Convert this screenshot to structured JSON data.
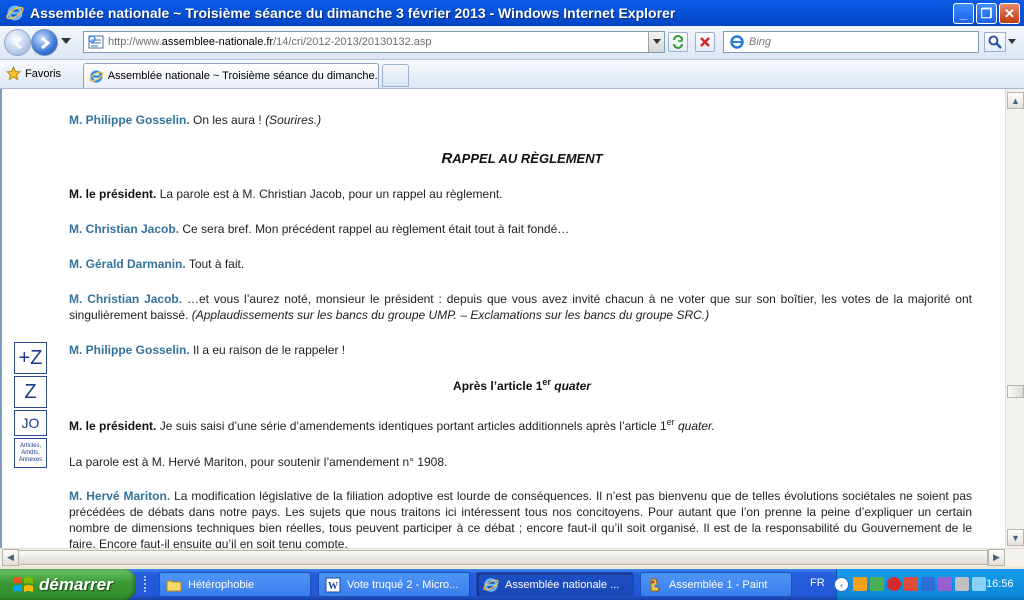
{
  "window": {
    "title": "Assemblée nationale ~ Troisième séance du dimanche 3 février 2013 - Windows Internet Explorer"
  },
  "navbar": {
    "url_prefix": "http://www.",
    "url_domain": "assemblee-nationale.fr",
    "url_path": "/14/cri/2012-2013/20130132.asp",
    "search_placeholder": "Bing"
  },
  "favbar": {
    "favorites_label": "Favoris",
    "tab_label": "Assemblée nationale ~ Troisième séance du dimanche..."
  },
  "content": {
    "p1": {
      "speaker": "M. Philippe Gosselin.",
      "text": " On les aura ! ",
      "aside": "(Sourires.)"
    },
    "heading1": {
      "first": "R",
      "rest": "APPEL AU RÈGLEMENT"
    },
    "p2": {
      "speaker": "M. le président.",
      "text": " La parole est à M. Christian Jacob, pour un rappel au règlement."
    },
    "p3": {
      "speaker": "M. Christian Jacob.",
      "text": " Ce sera bref. Mon précédent rappel au règlement était tout à fait fondé…"
    },
    "p4": {
      "speaker": "M. Gérald Darmanin.",
      "text": " Tout à fait."
    },
    "p5": {
      "speaker": "M. Christian Jacob.",
      "text": " …et vous l’aurez noté, monsieur le président : depuis que vous avez invité chacun à ne voter que sur son boîtier, les votes de la majorité ont singulièrement baissé. ",
      "aside": "(Applaudissements sur les bancs du groupe UMP. – Exclamations sur les bancs du groupe SRC.)"
    },
    "p6": {
      "speaker": "M. Philippe Gosselin.",
      "text": " Il a eu raison de le rappeler !"
    },
    "subhead": {
      "prefix": "Après l’article 1",
      "sup": "er",
      "suffix": " quater"
    },
    "p7": {
      "speaker": "M. le président.",
      "text": " Je suis saisi d’une série d’amendements identiques portant articles additionnels après l’article 1",
      "sup": "er",
      "suffix": " quater."
    },
    "p8": {
      "text": "La parole est à M. Hervé Mariton, pour soutenir l’amendement n° 1908."
    },
    "p9": {
      "speaker": "M. Hervé Mariton.",
      "text": " La modification législative de la filiation adoptive est lourde de conséquences. Il n’est pas bienvenu que de telles évolutions sociétales ne soient pas précédées de débats dans notre pays. Les sujets que nous traitons ici intéressent tous nos concitoyens. Pour autant que l’on prenne la peine d’expliquer un certain nombre de dimensions techniques bien réelles, tous peuvent participer à ce débat ; encore faut-il qu’il soit organisé. Il est de la responsabilité du Gouvernement de le faire. Encore faut-il ensuite qu’il en soit tenu compte."
    }
  },
  "sidebar": {
    "zoom_in_label": "+Z",
    "zoom_out_label": "Z",
    "jo_label": "JO",
    "annexes_label": "Articles, Amdts, Annexes"
  },
  "taskbar": {
    "start_label": "démarrer",
    "items": [
      {
        "label": "Hétérophobie"
      },
      {
        "label": "Vote truqué 2 - Micro..."
      },
      {
        "label": "Assemblée nationale ..."
      },
      {
        "label": "Assemblée 1 - Paint"
      }
    ],
    "language": "FR",
    "clock": "16:56"
  },
  "colors": {
    "speaker": "#35739d",
    "titlebar": "#0652d8",
    "taskbar": "#245edb",
    "start": "#3c9a35"
  }
}
